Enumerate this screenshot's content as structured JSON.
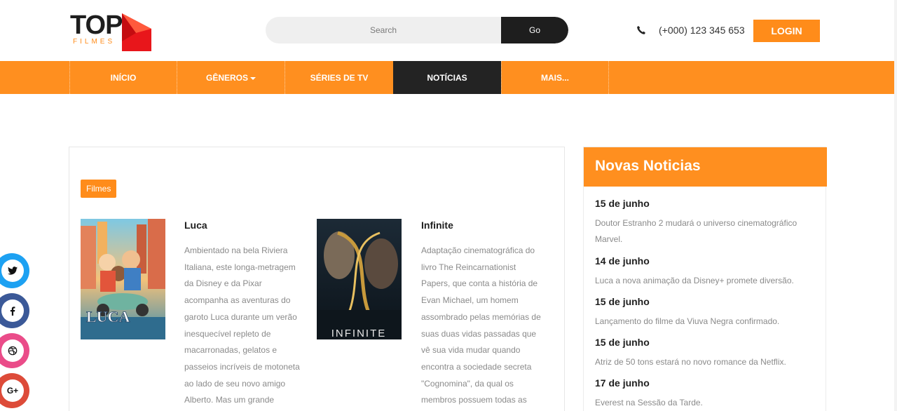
{
  "header": {
    "logo_text": "TOP",
    "logo_sub": "FILMES",
    "search_placeholder": "Search",
    "search_button": "Go",
    "phone": "(+000) 123 345 653",
    "login": "LOGIN"
  },
  "nav": {
    "items": [
      {
        "label": "INÍCIO"
      },
      {
        "label": "GÊNEROS"
      },
      {
        "label": "SÉRIES DE TV"
      },
      {
        "label": "NOTÍCIAS"
      },
      {
        "label": "MAIS..."
      }
    ],
    "active": "NOTÍCIAS"
  },
  "main": {
    "tag": "Filmes",
    "movies": [
      {
        "title": "Luca",
        "poster_caption": "LUCA",
        "description": "Ambientado na bela Riviera Italiana, este longa-metragem da Disney e da Pixar acompanha as aventuras do garoto Luca durante um verão inesquecível repleto de macarronadas, gelatos e passeios incríveis de motoneta ao lado de seu novo amigo Alberto. Mas um grande"
      },
      {
        "title": "Infinite",
        "poster_caption": "INFINITE",
        "description": "Adaptação cinematográfica do livro The Reincarnationist Papers, que conta a história de Evan Michael, um homem assombrado pelas memórias de suas duas vidas passadas que vê sua vida mudar quando encontra a sociedade secreta \"Cognomina\", da qual os membros possuem todas as"
      }
    ]
  },
  "sidebar": {
    "title": "Novas Noticias",
    "news": [
      {
        "date": "15 de junho",
        "text": "Doutor Estranho 2 mudará o universo cinematográfico Marvel."
      },
      {
        "date": "14 de junho",
        "text": "Luca a nova animação da Disney+ promete diversão."
      },
      {
        "date": "15 de junho",
        "text": "Lançamento do filme da Viuva Negra confirmado."
      },
      {
        "date": "15 de junho",
        "text": "Atriz de 50 tons estará no novo romance da Netflix."
      },
      {
        "date": "17 de junho",
        "text": "Everest na Sessão da Tarde."
      }
    ]
  },
  "social": [
    {
      "icon": "twitter-icon",
      "glyph": "🐦",
      "color": "#1da1f2"
    },
    {
      "icon": "facebook-icon",
      "glyph": "f",
      "color": "#3b5998"
    },
    {
      "icon": "dribbble-icon",
      "glyph": "◎",
      "color": "#ea4c89"
    },
    {
      "icon": "google-plus-icon",
      "glyph": "G+",
      "color": "#dd4b39"
    }
  ],
  "colors": {
    "accent": "#ff8f1f",
    "dark": "#232323"
  }
}
